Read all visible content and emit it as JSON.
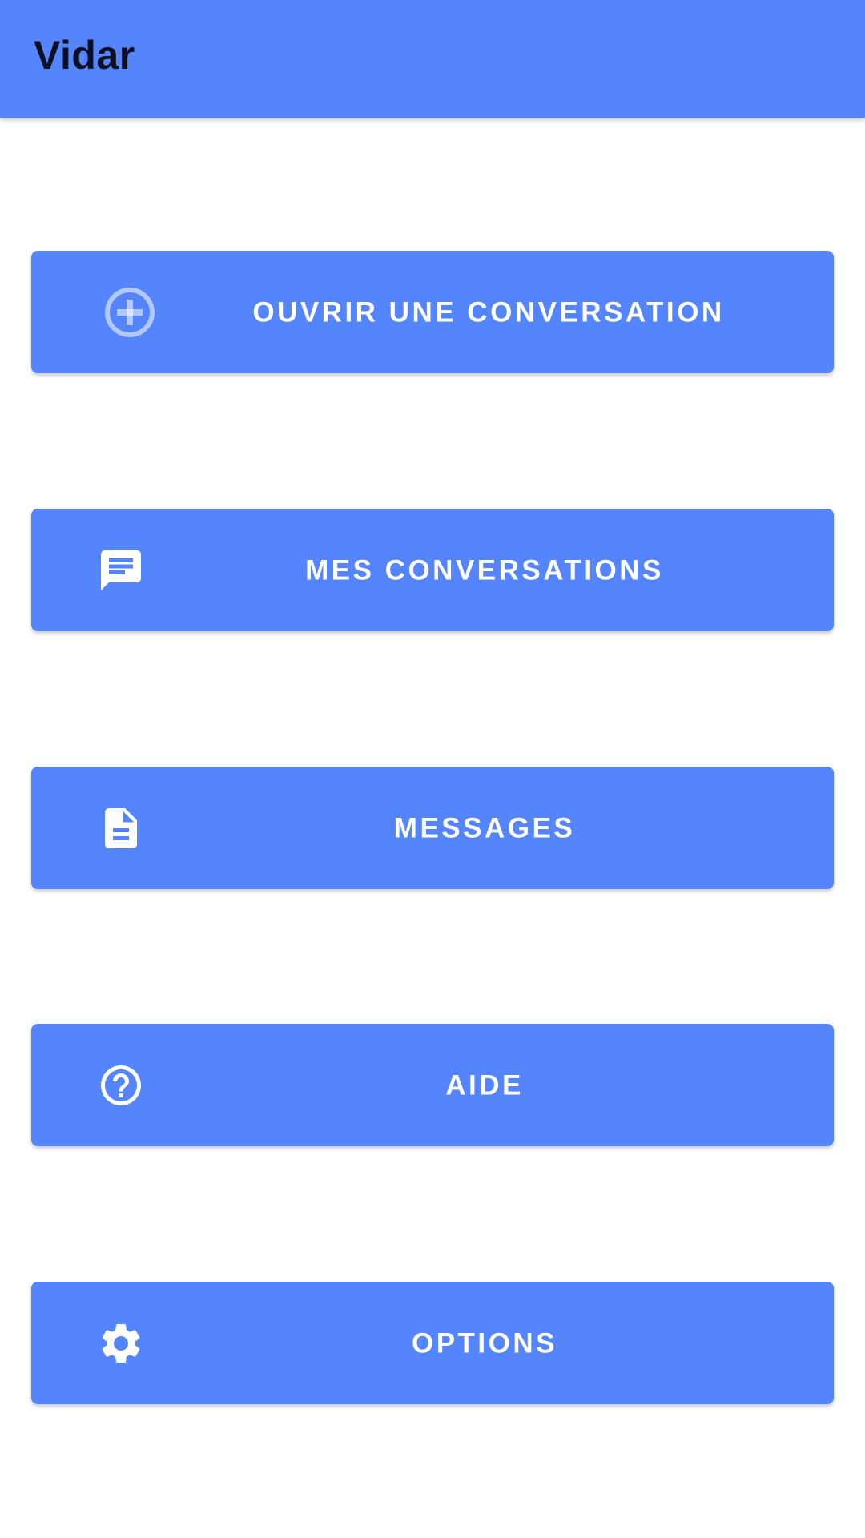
{
  "app_bar": {
    "title": "Vidar",
    "color": "#5585fc"
  },
  "menu": {
    "items": [
      {
        "label": "OUVRIR UNE CONVERSATION",
        "icon": "add-circle-icon"
      },
      {
        "label": "MES CONVERSATIONS",
        "icon": "chat-icon"
      },
      {
        "label": "MESSAGES",
        "icon": "document-icon"
      },
      {
        "label": "AIDE",
        "icon": "help-icon"
      },
      {
        "label": "OPTIONS",
        "icon": "settings-icon"
      }
    ],
    "button_color": "#5585fc",
    "text_color": "#ffffff"
  }
}
